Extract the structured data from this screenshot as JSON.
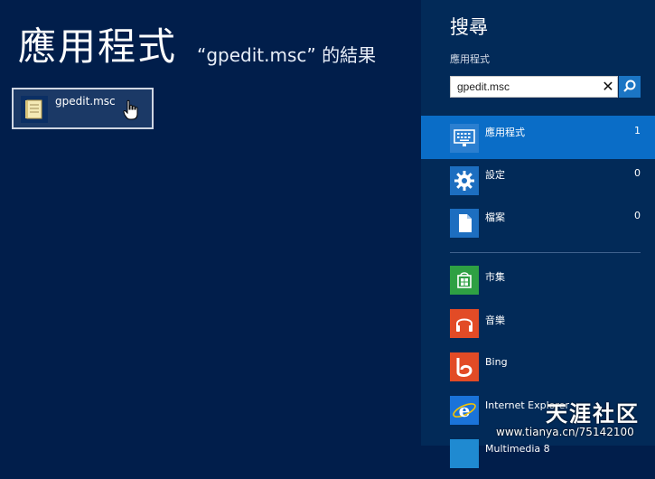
{
  "results": {
    "title": "應用程式",
    "subtitle": "“gpedit.msc” 的結果",
    "tile": {
      "label": "gpedit.msc",
      "icon": "document-scroll-icon"
    }
  },
  "charm": {
    "title": "搜尋",
    "scope_label": "應用程式",
    "search": {
      "value": "gpedit.msc",
      "clear_icon": "✕",
      "go_icon": "search-icon"
    },
    "categories": [
      {
        "label": "應用程式",
        "count": "1",
        "icon": "keyboard-monitor-icon",
        "selected": true
      },
      {
        "label": "設定",
        "count": "0",
        "icon": "gear-icon",
        "selected": false
      },
      {
        "label": "檔案",
        "count": "0",
        "icon": "file-icon",
        "selected": false
      }
    ],
    "apps": [
      {
        "label": "市集",
        "icon": "store-icon",
        "color": "#2ea043"
      },
      {
        "label": "音樂",
        "icon": "headphones-icon",
        "color": "#e24b26"
      },
      {
        "label": "Bing",
        "icon": "bing-icon",
        "color": "#e24b26"
      },
      {
        "label": "Internet Explorer",
        "icon": "internet-explorer-icon",
        "color": "#1a73d9"
      },
      {
        "label": "Multimedia 8",
        "icon": "multimedia-icon",
        "color": "#1f8ad1"
      }
    ]
  },
  "watermark": {
    "brand": "天涯社区",
    "url": "www.tianya.cn/75142100"
  }
}
